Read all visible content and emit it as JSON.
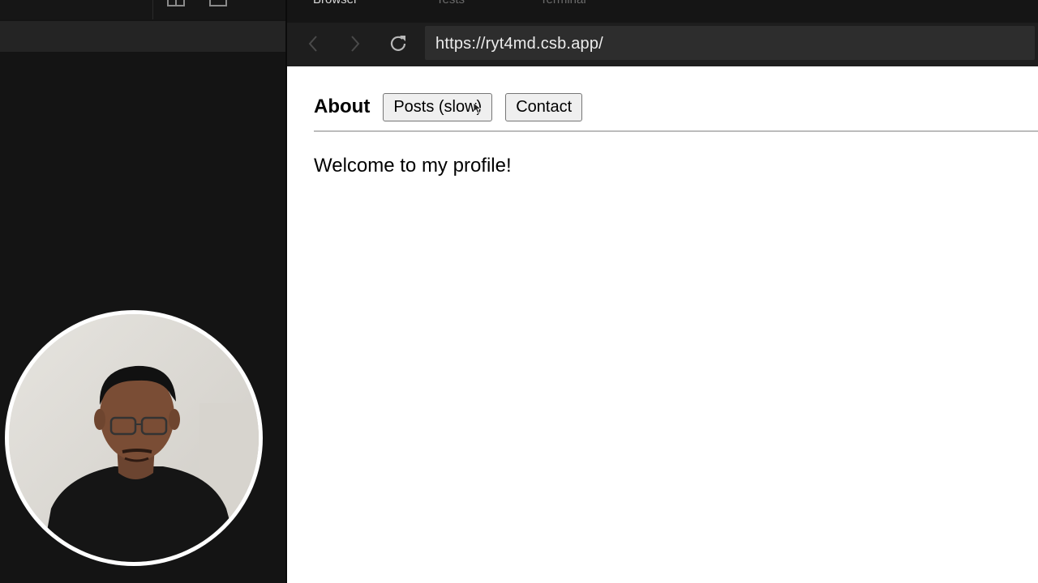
{
  "browser": {
    "tabs": [
      "Browser",
      "Tests",
      "Terminal"
    ],
    "url": "https://ryt4md.csb.app/"
  },
  "page": {
    "nav_title": "About",
    "buttons": [
      "Posts (slow)",
      "Contact"
    ],
    "welcome_text": "Welcome to my profile!"
  },
  "icons": {
    "back": "chevron-left-icon",
    "forward": "chevron-right-icon",
    "reload": "reload-icon"
  },
  "colors": {
    "editor_bg": "#141414",
    "nav_bar_bg": "#1e1e1e",
    "url_box_bg": "#2d2d2d",
    "page_bg": "#ffffff",
    "button_bg": "#efefef"
  }
}
